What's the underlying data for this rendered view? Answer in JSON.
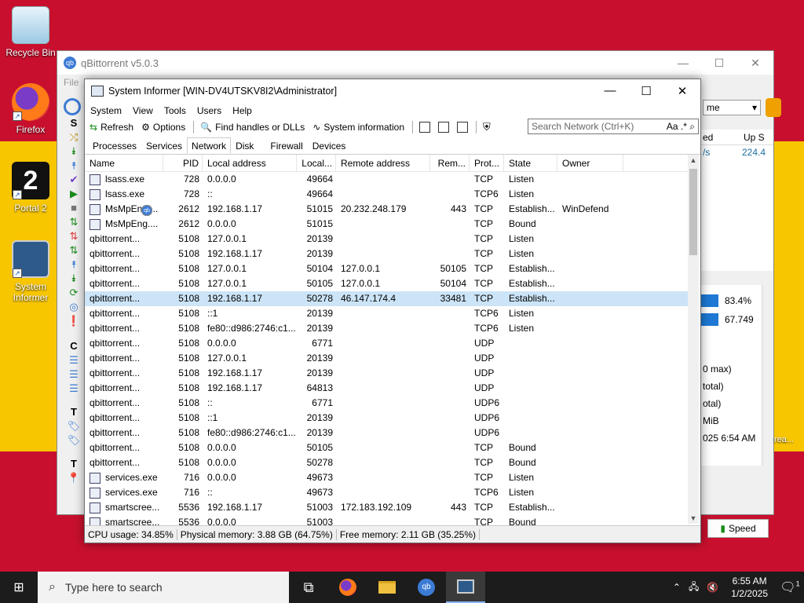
{
  "desktop": {
    "icons": [
      {
        "label": "Recycle Bin",
        "icon": "recycle-bin-icon"
      },
      {
        "label": "Firefox",
        "icon": "firefox-icon"
      },
      {
        "label": "Portal 2",
        "icon": "portal2-icon"
      },
      {
        "label": "System Informer",
        "icon": "system-informer-icon"
      }
    ]
  },
  "qbittorrent": {
    "title": "qBittorrent v5.0.3",
    "menu_file": "File",
    "right_header_ed": "ed",
    "right_header_upspeed": "Up S",
    "right_speed_s": "/s",
    "right_speed_val": "224.4",
    "stat_pct1": "83.4%",
    "stat_val2": "67.749",
    "info_lines": [
      "0 max)",
      "total)",
      "otal)",
      "MiB",
      "025 6:54 AM"
    ],
    "speed_button": "Speed",
    "combo_value": "me",
    "left_section_s": "S",
    "left_section_c": "C",
    "left_section_t1": "T",
    "left_section_t2": "T",
    "desktop_overlay": "rea..."
  },
  "sysinformer": {
    "title": "System Informer [WIN-DV4UTSKV8I2\\Administrator]",
    "menu": [
      "System",
      "View",
      "Tools",
      "Users",
      "Help"
    ],
    "toolbar": {
      "refresh": "Refresh",
      "options": "Options",
      "find_handles": "Find handles or DLLs",
      "system_information": "System information"
    },
    "search_placeholder": "Search Network (Ctrl+K)",
    "search_aa": "Aa",
    "search_regex": ".*",
    "tabs": [
      "Processes",
      "Services",
      "Network",
      "Disk",
      "Firewall",
      "Devices"
    ],
    "active_tab": "Network",
    "columns": [
      "Name",
      "PID",
      "Local address",
      "Local...",
      "Remote address",
      "Rem...",
      "Prot...",
      "State",
      "Owner"
    ],
    "rows": [
      [
        "lsass.exe",
        "728",
        "0.0.0.0",
        "49664",
        "",
        "",
        "TCP",
        "Listen",
        ""
      ],
      [
        "lsass.exe",
        "728",
        "::",
        "49664",
        "",
        "",
        "TCP6",
        "Listen",
        ""
      ],
      [
        "MsMpEng....",
        "2612",
        "192.168.1.17",
        "51015",
        "20.232.248.179",
        "443",
        "TCP",
        "Establish...",
        "WinDefend"
      ],
      [
        "MsMpEng....",
        "2612",
        "0.0.0.0",
        "51015",
        "",
        "",
        "TCP",
        "Bound",
        ""
      ],
      [
        "qbittorrent...",
        "5108",
        "127.0.0.1",
        "20139",
        "",
        "",
        "TCP",
        "Listen",
        ""
      ],
      [
        "qbittorrent...",
        "5108",
        "192.168.1.17",
        "20139",
        "",
        "",
        "TCP",
        "Listen",
        ""
      ],
      [
        "qbittorrent...",
        "5108",
        "127.0.0.1",
        "50104",
        "127.0.0.1",
        "50105",
        "TCP",
        "Establish...",
        ""
      ],
      [
        "qbittorrent...",
        "5108",
        "127.0.0.1",
        "50105",
        "127.0.0.1",
        "50104",
        "TCP",
        "Establish...",
        ""
      ],
      [
        "qbittorrent...",
        "5108",
        "192.168.1.17",
        "50278",
        "46.147.174.4",
        "33481",
        "TCP",
        "Establish...",
        ""
      ],
      [
        "qbittorrent...",
        "5108",
        "::1",
        "20139",
        "",
        "",
        "TCP6",
        "Listen",
        ""
      ],
      [
        "qbittorrent...",
        "5108",
        "fe80::d986:2746:c1...",
        "20139",
        "",
        "",
        "TCP6",
        "Listen",
        ""
      ],
      [
        "qbittorrent...",
        "5108",
        "0.0.0.0",
        "6771",
        "",
        "",
        "UDP",
        "",
        ""
      ],
      [
        "qbittorrent...",
        "5108",
        "127.0.0.1",
        "20139",
        "",
        "",
        "UDP",
        "",
        ""
      ],
      [
        "qbittorrent...",
        "5108",
        "192.168.1.17",
        "20139",
        "",
        "",
        "UDP",
        "",
        ""
      ],
      [
        "qbittorrent...",
        "5108",
        "192.168.1.17",
        "64813",
        "",
        "",
        "UDP",
        "",
        ""
      ],
      [
        "qbittorrent...",
        "5108",
        "::",
        "6771",
        "",
        "",
        "UDP6",
        "",
        ""
      ],
      [
        "qbittorrent...",
        "5108",
        "::1",
        "20139",
        "",
        "",
        "UDP6",
        "",
        ""
      ],
      [
        "qbittorrent...",
        "5108",
        "fe80::d986:2746:c1...",
        "20139",
        "",
        "",
        "UDP6",
        "",
        ""
      ],
      [
        "qbittorrent...",
        "5108",
        "0.0.0.0",
        "50105",
        "",
        "",
        "TCP",
        "Bound",
        ""
      ],
      [
        "qbittorrent...",
        "5108",
        "0.0.0.0",
        "50278",
        "",
        "",
        "TCP",
        "Bound",
        ""
      ],
      [
        "services.exe",
        "716",
        "0.0.0.0",
        "49673",
        "",
        "",
        "TCP",
        "Listen",
        ""
      ],
      [
        "services.exe",
        "716",
        "::",
        "49673",
        "",
        "",
        "TCP6",
        "Listen",
        ""
      ],
      [
        "smartscree...",
        "5536",
        "192.168.1.17",
        "51003",
        "172.183.192.109",
        "443",
        "TCP",
        "Establish...",
        ""
      ],
      [
        "smartscree...",
        "5536",
        "0.0.0.0",
        "51003",
        "",
        "",
        "TCP",
        "Bound",
        ""
      ]
    ],
    "selected_row": 8,
    "status": {
      "cpu": "CPU usage: 34.85%",
      "physical": "Physical memory: 3.88 GB (64.75%)",
      "free": "Free memory: 2.11 GB (35.25%)"
    }
  },
  "taskbar": {
    "search_placeholder": "Type here to search",
    "time": "6:55 AM",
    "date": "1/2/2025",
    "notifications": "1"
  }
}
